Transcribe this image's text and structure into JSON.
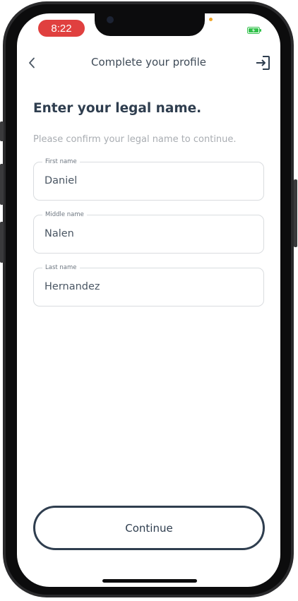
{
  "status_bar": {
    "time": "8:22",
    "time_pill_color": "#e0403f",
    "indicator_dot_color": "#f0a426",
    "battery_color": "#31c14a",
    "battery_icon": "charging-battery-icon"
  },
  "header": {
    "title": "Complete your profile",
    "back_icon": "chevron-left-icon",
    "exit_icon": "sign-out-icon"
  },
  "main": {
    "heading": "Enter your legal name.",
    "subtext": "Please confirm your legal name to continue.",
    "fields": [
      {
        "label": "First name",
        "value": "Daniel"
      },
      {
        "label": "Middle name",
        "value": "Nalen"
      },
      {
        "label": "Last name",
        "value": "Hernandez"
      }
    ]
  },
  "footer": {
    "continue_label": "Continue",
    "accent_color": "#2f3e4f"
  }
}
